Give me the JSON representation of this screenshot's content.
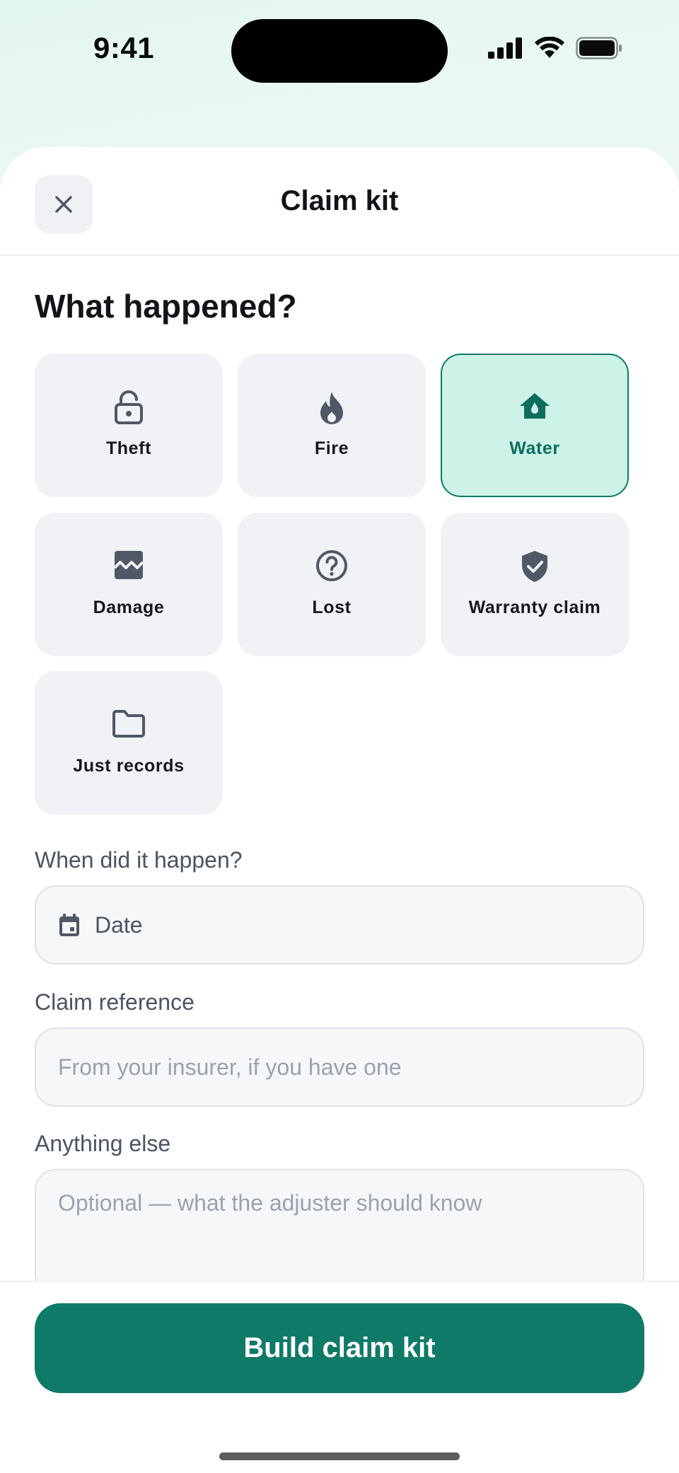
{
  "status_bar": {
    "time": "9:41"
  },
  "header": {
    "title": "Claim kit",
    "close_icon": "close-icon"
  },
  "incident": {
    "heading": "What happened?",
    "selected": "Water",
    "options": [
      {
        "label": "Theft",
        "icon": "lock-icon"
      },
      {
        "label": "Fire",
        "icon": "flame-icon"
      },
      {
        "label": "Water",
        "icon": "water-home-icon"
      },
      {
        "label": "Damage",
        "icon": "broken-image-icon"
      },
      {
        "label": "Lost",
        "icon": "question-circle-icon"
      },
      {
        "label": "Warranty claim",
        "icon": "shield-check-icon"
      },
      {
        "label": "Just records",
        "icon": "folder-icon"
      }
    ]
  },
  "form": {
    "date_label": "When did it happen?",
    "date_value": "Date",
    "reference_label": "Claim reference",
    "reference_placeholder": "From your insurer, if you have one",
    "notes_label": "Anything else",
    "notes_placeholder": "Optional — what the adjuster should know"
  },
  "footer": {
    "submit_label": "Build claim kit"
  },
  "colors": {
    "accent": "#0f7a68",
    "selected_bg": "#cdf3e8",
    "tile_bg": "#f1f2f5",
    "icon_gray": "#4f5866"
  }
}
